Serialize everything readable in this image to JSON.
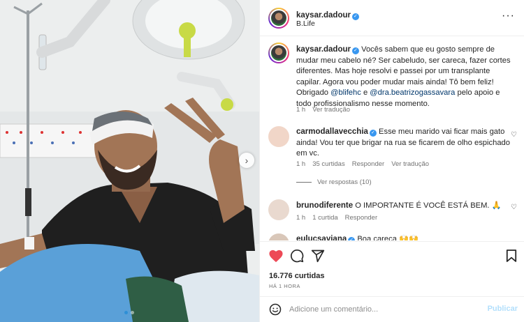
{
  "post": {
    "author": "kaysar.dadour",
    "location": "B.Life",
    "caption_text": "Vocês sabem que eu gosto sempre de mudar meu cabelo né? Ser cabeludo, ser careca, fazer cortes diferentes. Mas hoje resolvi e passei por um transplante capilar. Agora vou poder mudar mais ainda! Tô bem feliz! Obrigado ",
    "caption_mention1": "@blifehc",
    "caption_mid": " e ",
    "caption_mention2": "@dra.beatrizogassavara",
    "caption_end": " pelo apoio e todo profissionalismo nesse momento.",
    "caption_time": "1 h",
    "caption_translate": "Ver tradução"
  },
  "comments": [
    {
      "user": "carmodallavecchia",
      "text": "Esse meu marido vai ficar mais gato ainda! Vou ter que brigar na rua se ficarem de olho espichado em vc.",
      "time": "1 h",
      "likes": "35 curtidas",
      "reply": "Responder",
      "translate": "Ver tradução",
      "view_replies": "Ver respostas (10)"
    },
    {
      "user": "brunodiferente",
      "text": "O IMPORTANTE É VOCÊ ESTÁ BEM. 🙏",
      "time": "1 h",
      "likes": "1 curtida",
      "reply": "Responder"
    },
    {
      "user": "eulucsaviana",
      "text": "Boa careca 🙌🙌"
    }
  ],
  "footer": {
    "likes_count": "16.776 curtidas",
    "posted_ago": "HÁ 1 HORA",
    "comment_placeholder": "Adicione um comentário...",
    "publish_label": "Publicar"
  },
  "carousel": {
    "slides": 2,
    "current": 1
  },
  "icons": {
    "more": "more-options-icon",
    "like": "heart-filled-icon",
    "comment": "comment-icon",
    "share": "share-icon",
    "save": "bookmark-icon",
    "emoji": "emoji-icon",
    "next": "chevron-right-icon"
  },
  "colors": {
    "heart": "#ed4956",
    "verified": "#3897f0",
    "link": "#00376b",
    "publish_disabled": "#b2dffc"
  }
}
